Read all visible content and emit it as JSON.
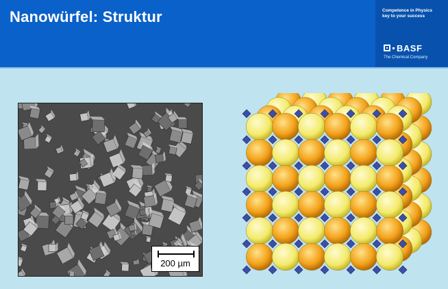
{
  "slide": {
    "title": "Nanowürfel: Struktur",
    "colors": {
      "header": "#0a61c9",
      "background": "#bfe3ef"
    }
  },
  "brand": {
    "tagline_line1": "Competence in Physics",
    "tagline_line2": "key to your success",
    "logo": "BASF",
    "company": "The Chemical Company"
  },
  "sem_image": {
    "scale_label": "200 µm"
  }
}
